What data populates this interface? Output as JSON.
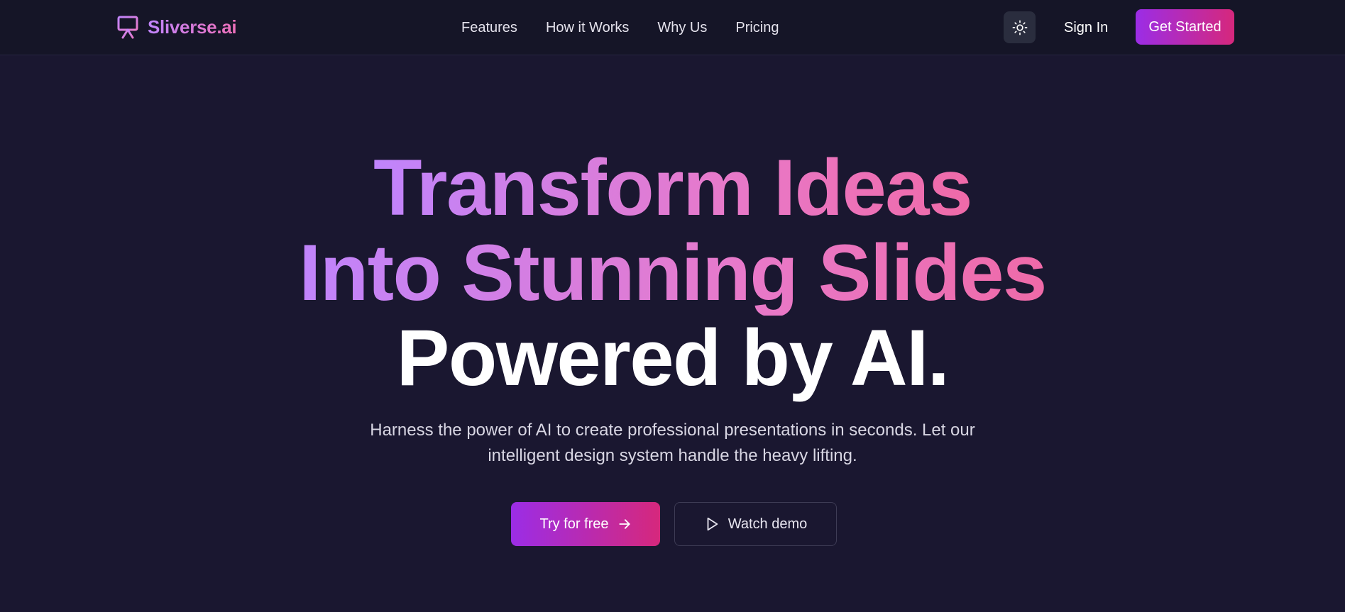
{
  "header": {
    "logo_text": "Sliverse.ai",
    "logo_icon": "presentation-icon",
    "nav": [
      {
        "label": "Features"
      },
      {
        "label": "How it Works"
      },
      {
        "label": "Why Us"
      },
      {
        "label": "Pricing"
      }
    ],
    "theme_toggle_icon": "sun-icon",
    "sign_in_label": "Sign In",
    "get_started_label": "Get Started"
  },
  "hero": {
    "title_line1": "Transform Ideas",
    "title_line2": "Into Stunning Slides",
    "title_line3": "Powered by AI.",
    "subtitle_line1": "Harness the power of AI to create professional presentations in seconds. Let our",
    "subtitle_line2": "intelligent design system handle the heavy lifting.",
    "primary_cta_label": "Try for free",
    "primary_cta_icon": "arrow-right-icon",
    "secondary_cta_label": "Watch demo",
    "secondary_cta_icon": "play-icon"
  },
  "colors": {
    "background": "#1a1730",
    "header_background": "#151527",
    "gradient_start": "#9b2de6",
    "gradient_end": "#d6287c",
    "title_gradient_start": "#c084fc",
    "title_gradient_end": "#ef6aa8"
  }
}
